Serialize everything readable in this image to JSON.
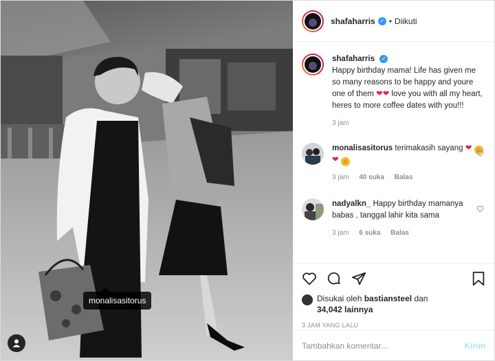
{
  "post": {
    "author": "shafaharris",
    "follow_status": "Diikuti",
    "dot": "•",
    "caption": "Happy birthday mama! Life has given me so many reasons to be happy and youre one of them",
    "caption_tail": "love you with all my heart, heres to more coffee dates with you!!!",
    "caption_time": "3 jam",
    "photo_tag": "monalisasitorus"
  },
  "comments": [
    {
      "user": "monalisasitorus",
      "text": "terimakasih sayang",
      "time": "3 jam",
      "likes": "40 suka",
      "reply": "Balas"
    },
    {
      "user": "nadyalkn_",
      "text": "Happy birthday mamanya babas , tanggal lahir kita sama",
      "time": "3 jam",
      "likes": "6 suka",
      "reply": "Balas"
    }
  ],
  "likes": {
    "prefix": "Disukai oleh",
    "user": "bastiansteel",
    "connector": "dan",
    "count": "34,042 lainnya"
  },
  "time_ago": "3 JAM YANG LALU",
  "comment_box": {
    "placeholder": "Tambahkan komentar...",
    "post_label": "Kirim"
  },
  "icons": [
    "heart-icon",
    "comment-icon",
    "share-icon",
    "bookmark-icon",
    "user-tag-icon",
    "verified-icon"
  ],
  "colors": {
    "verified": "#3897f0",
    "post_button": "#b2dffc",
    "muted": "#8e8e8e"
  }
}
